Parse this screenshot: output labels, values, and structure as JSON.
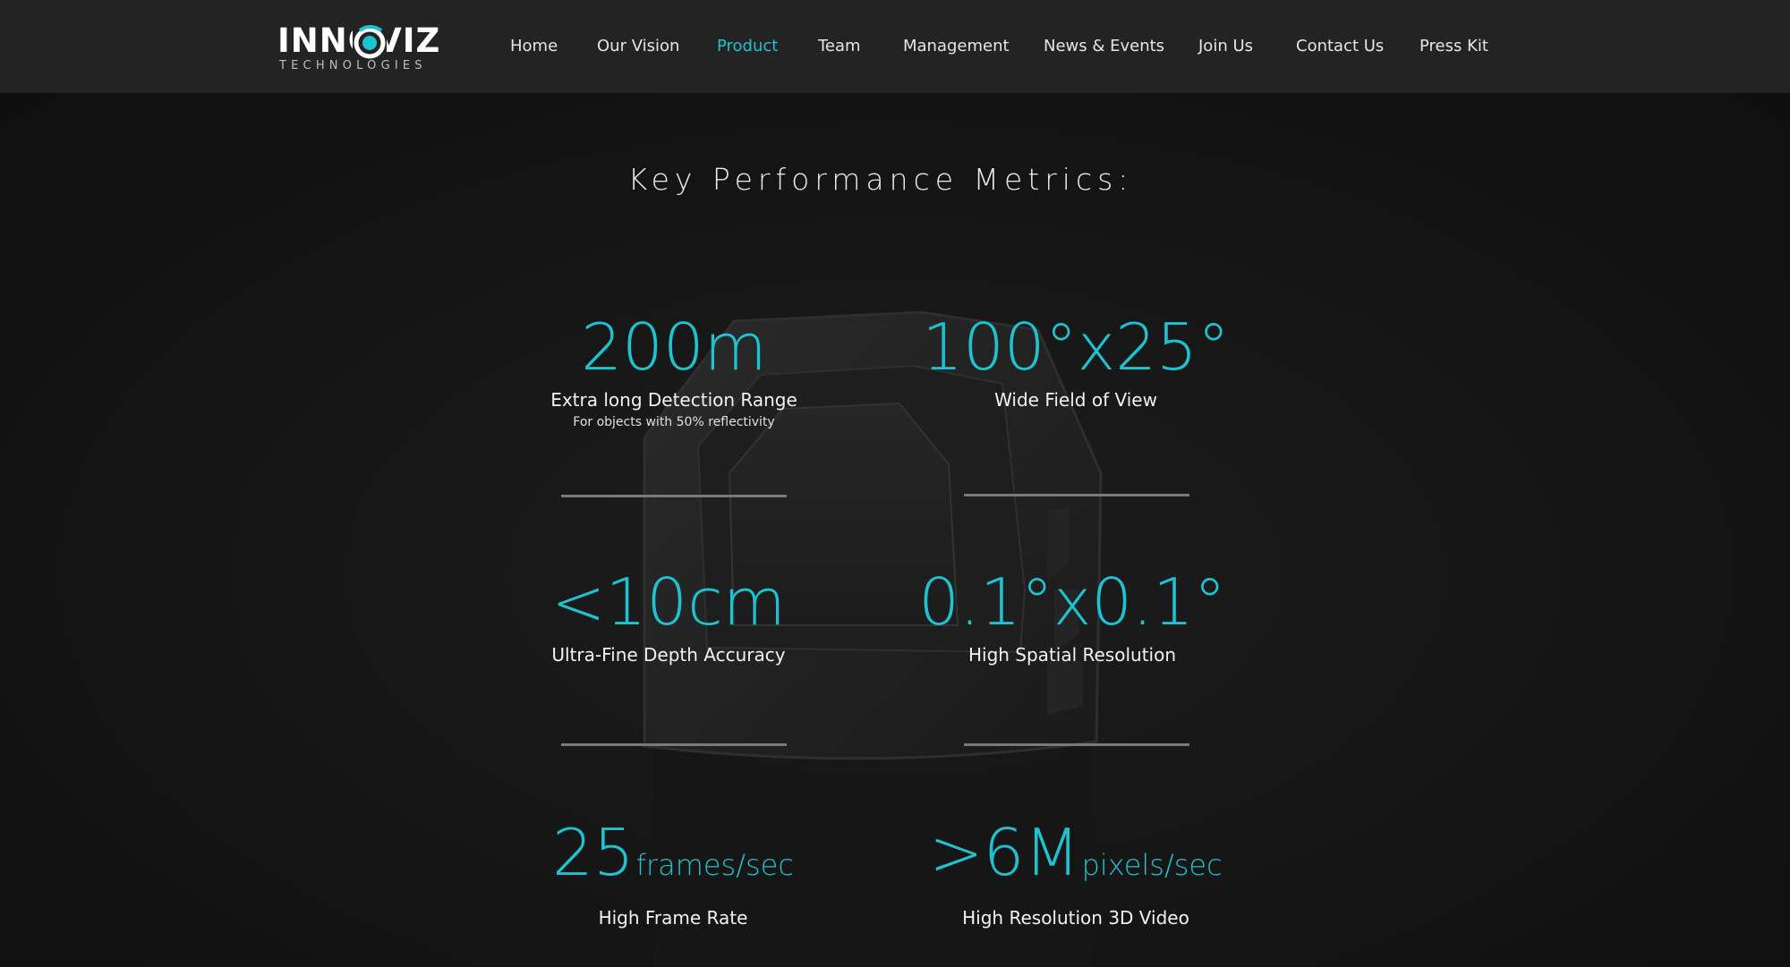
{
  "logo": {
    "main": "INNOVIZ",
    "sub": "TECHNOLOGIES",
    "accent_color": "#1ec3d0",
    "icon": "eye-icon"
  },
  "nav": {
    "items": [
      {
        "label": "Home",
        "active": false
      },
      {
        "label": "Our Vision",
        "active": false
      },
      {
        "label": "Product",
        "active": true
      },
      {
        "label": "Team",
        "active": false
      },
      {
        "label": "Management",
        "active": false
      },
      {
        "label": "News & Events",
        "active": false
      },
      {
        "label": "Join Us",
        "active": false
      },
      {
        "label": "Contact Us",
        "active": false
      },
      {
        "label": "Press Kit",
        "active": false
      }
    ],
    "active_color": "#1ec3d0"
  },
  "section": {
    "title": "Key Performance Metrics:"
  },
  "metrics": [
    {
      "value": "200m",
      "unit": "",
      "label": "Extra long Detection Range",
      "note": "For objects with 50% reflectivity"
    },
    {
      "value": "100°x25°",
      "unit": "",
      "label": "Wide Field of View",
      "note": ""
    },
    {
      "value": "<10cm",
      "unit": "",
      "label": "Ultra-Fine Depth Accuracy",
      "note": ""
    },
    {
      "value": "0.1°x0.1°",
      "unit": "",
      "label": "High Spatial Resolution",
      "note": ""
    },
    {
      "value": "25",
      "unit": "frames/sec",
      "label": "High Frame Rate",
      "note": ""
    },
    {
      "value": ">6M",
      "unit": "pixels/sec",
      "label": "High Resolution 3D Video",
      "note": ""
    }
  ],
  "colors": {
    "accent": "#1ec3d0",
    "header_bg": "#232323",
    "page_bg": "#151515"
  }
}
